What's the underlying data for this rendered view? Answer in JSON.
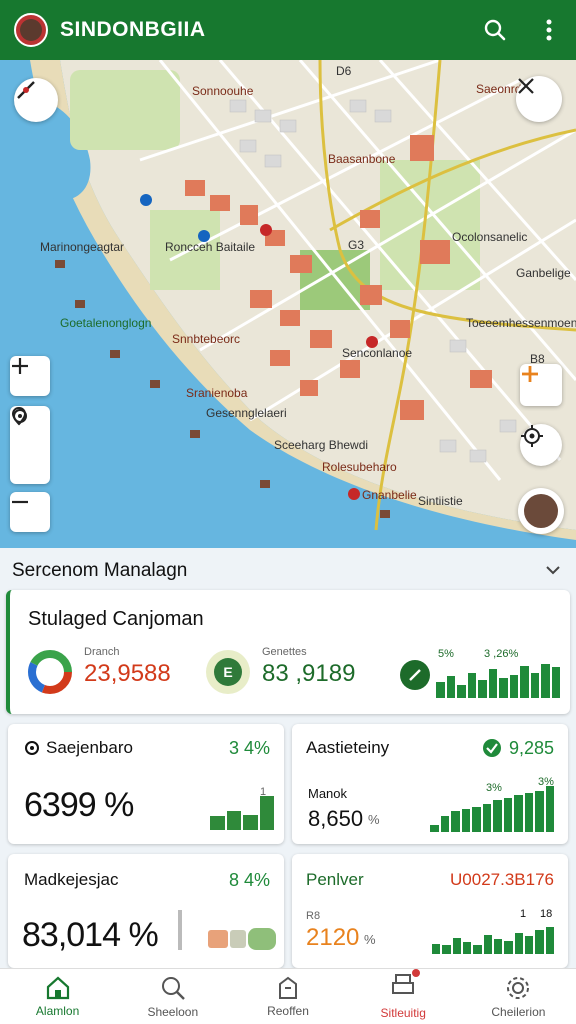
{
  "app": {
    "title": "SINDONBGIIA"
  },
  "icons": {
    "search": "search-icon",
    "more": "more-vert-icon",
    "compass": "compass-icon",
    "close": "close-icon",
    "zoom_in": "plus-icon",
    "zoom_out": "minus-icon",
    "pin": "pin-icon",
    "locate": "crosshair-icon",
    "add": "add-icon"
  },
  "map": {
    "labels": [
      "Sonnoouhe",
      "Marinongeagtar",
      "Roncceh Baitaile",
      "Goetalenonglogn",
      "Sranienoba",
      "Gesennglelaeri",
      "Sceeharg Bhewdi",
      "Rolesubeharo",
      "Gnanbelie",
      "Sintiistie",
      "Ganbelige",
      "Toeeemhessenmoentee",
      "Senconlanoe",
      "Saeonrdes",
      "Ocolonsanelic",
      "Snnbtebeorc",
      "Baasanbone",
      "D6",
      "G3",
      "B8"
    ],
    "accent": "#e8821e"
  },
  "panel": {
    "title": "Sercenom Manalagn",
    "main_card": {
      "title": "Stulaged Canjoman",
      "donut_label": "Dranch",
      "donut_value": "23,9588",
      "mid_label": "Genettes",
      "mid_icon_text": "E",
      "mid_value": "83 ,9189",
      "bars_left_label": "5%",
      "bars_right_label": "3 ,26%",
      "bars": [
        0.45,
        0.6,
        0.35,
        0.7,
        0.5,
        0.8,
        0.55,
        0.65,
        0.9,
        0.7,
        0.95,
        0.85
      ]
    },
    "card1": {
      "title": "Saejenbaro",
      "pct": "3 4%",
      "value": "6399 %",
      "bar_label": "1",
      "bars": [
        0.4,
        0.55,
        0.45,
        1.0
      ]
    },
    "card2": {
      "title": "Aastieteiny",
      "pct": "9,285",
      "sub_label": "Manok",
      "value": "8,650",
      "unit": "%",
      "bar_label_a": "3%",
      "bar_label_b": "3%",
      "bars": [
        0.15,
        0.35,
        0.45,
        0.5,
        0.55,
        0.6,
        0.7,
        0.75,
        0.8,
        0.85,
        0.9,
        1.0
      ]
    },
    "card3": {
      "title": "Madkejesjac",
      "pct": "8 4%",
      "value": "83,014 %"
    },
    "card4": {
      "title": "Penlver",
      "pct": "U0027.3B176",
      "sub_label": "R8",
      "value": "2120",
      "unit": "%",
      "bar_label_a": "1",
      "bar_label_b": "18",
      "bars": [
        0.35,
        0.3,
        0.55,
        0.4,
        0.3,
        0.65,
        0.5,
        0.45,
        0.7,
        0.6,
        0.8,
        0.9
      ]
    }
  },
  "nav": [
    {
      "label": "Alamlon",
      "icon": "home-icon"
    },
    {
      "label": "Sheeloon",
      "icon": "search-icon"
    },
    {
      "label": "Reoffen",
      "icon": "receipt-icon"
    },
    {
      "label": "Sitleuitig",
      "icon": "printer-icon"
    },
    {
      "label": "Cheilerion",
      "icon": "settings-icon"
    }
  ]
}
